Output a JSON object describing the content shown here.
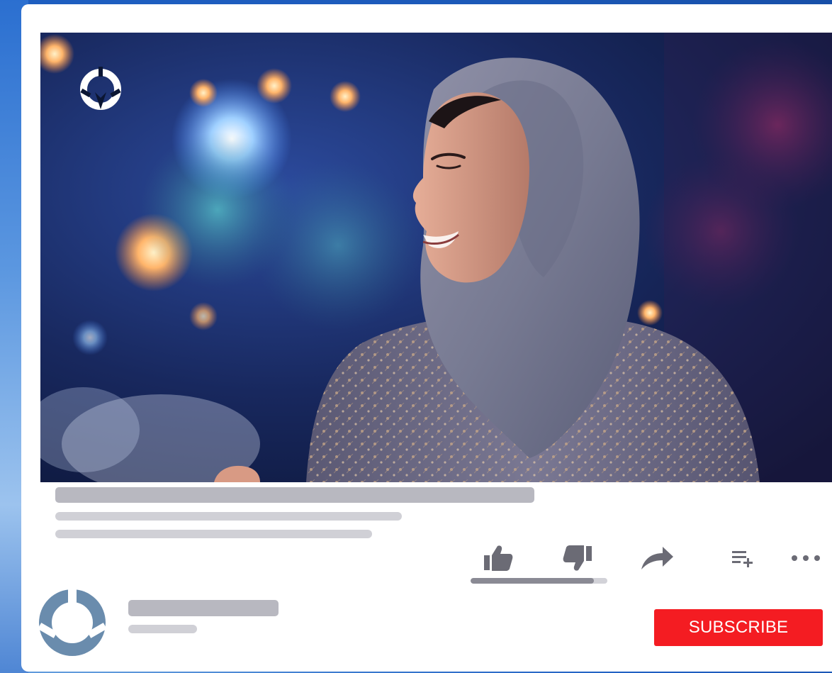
{
  "video": {
    "logo_icon": "brand-logo-icon",
    "palette": {
      "background": "#0b1633",
      "scarf": "#7b7f97",
      "dress": "#6e6d8a",
      "skin": "#d59882",
      "bokeh_warm": "#ffb56b",
      "bokeh_cool": "#7fb8ff"
    }
  },
  "actions": {
    "like_icon": "thumbs-up-icon",
    "dislike_icon": "thumbs-down-icon",
    "share_icon": "share-arrow-icon",
    "playlist_icon": "add-to-playlist-icon",
    "more_icon": "more-options-icon",
    "like_ratio": 0.9
  },
  "channel": {
    "avatar_icon": "channel-logo-icon"
  },
  "subscribe": {
    "label": "SUBSCRIBE",
    "color": "#f41c22"
  },
  "colors": {
    "background": "#1f5fc2",
    "card": "#ffffff",
    "skeleton": "#b8b8c0",
    "skeleton_light": "#d0d0d6",
    "icon": "#6b6b75",
    "brand_logo": "#6a8cad"
  }
}
